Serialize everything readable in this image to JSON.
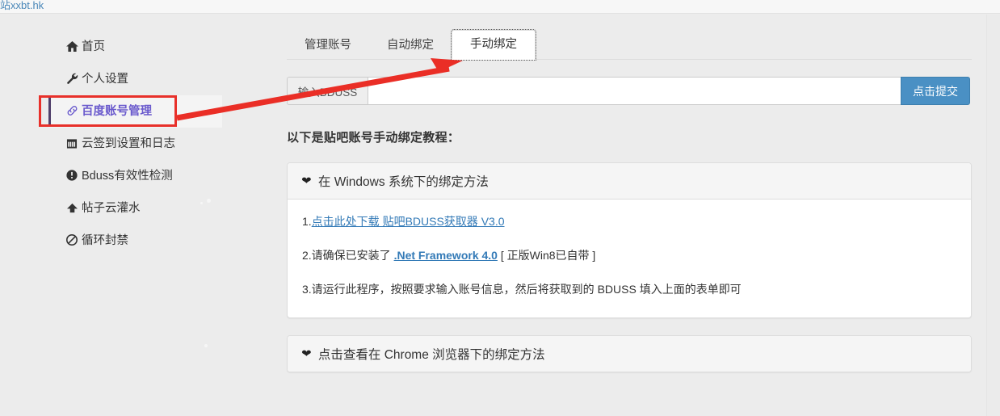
{
  "topbar": {
    "link_text": "站xxbt.hk"
  },
  "sidebar": {
    "items": [
      {
        "icon": "home-icon",
        "glyph": "⌂",
        "label": "首页",
        "active": false
      },
      {
        "icon": "wrench-icon",
        "glyph": "🔧",
        "label": "个人设置",
        "active": false
      },
      {
        "icon": "link-icon",
        "glyph": "🔗",
        "label": "百度账号管理",
        "active": true
      },
      {
        "icon": "calendar-icon",
        "glyph": "▦",
        "label": "云签到设置和日志",
        "active": false
      },
      {
        "icon": "info-icon",
        "glyph": "❶",
        "label": "Bduss有效性检测",
        "active": false
      },
      {
        "icon": "upload-icon",
        "glyph": "⬆",
        "label": "帖子云灌水",
        "active": false
      },
      {
        "icon": "ban-icon",
        "glyph": "⊘",
        "label": "循环封禁",
        "active": false
      }
    ]
  },
  "main": {
    "tabs": [
      {
        "label": "管理账号",
        "active": false
      },
      {
        "label": "自动绑定",
        "active": false
      },
      {
        "label": "手动绑定",
        "active": true
      }
    ],
    "form": {
      "addon_label": "输入BDUSS",
      "input_value": "",
      "input_placeholder": "",
      "submit_label": "点击提交"
    },
    "intro_text": "以下是贴吧账号手动绑定教程：",
    "panels": [
      {
        "caret": "caret-down-icon",
        "title": "在 Windows 系统下的绑定方法",
        "collapsed": false,
        "lines": [
          {
            "prefix": "1.",
            "link": "点击此处下载 贴吧BDUSS获取器 V3.0",
            "link_style": "normal",
            "suffix": ""
          },
          {
            "prefix": "2.请确保已安装了 ",
            "link": ".Net Framework 4.0",
            "link_style": "bold",
            "suffix": " [ 正版Win8已自带 ]"
          },
          {
            "prefix": "3.请运行此程序，按照要求输入账号信息，然后将获取到的 BDUSS 填入上面的表单即可",
            "link": "",
            "link_style": "none",
            "suffix": ""
          }
        ]
      },
      {
        "caret": "caret-down-icon",
        "title": "点击查看在 Chrome 浏览器下的绑定方法",
        "collapsed": true,
        "lines": []
      }
    ]
  },
  "annotations": {
    "arrow_color": "#ea2e26",
    "highlight_box_color": "#e8302a",
    "caret_glyph": "❤"
  },
  "colors": {
    "page_background": "#ececec",
    "accent_purple": "#6a5acd",
    "link_blue": "#337ab7",
    "button_blue": "#4a90c4"
  }
}
